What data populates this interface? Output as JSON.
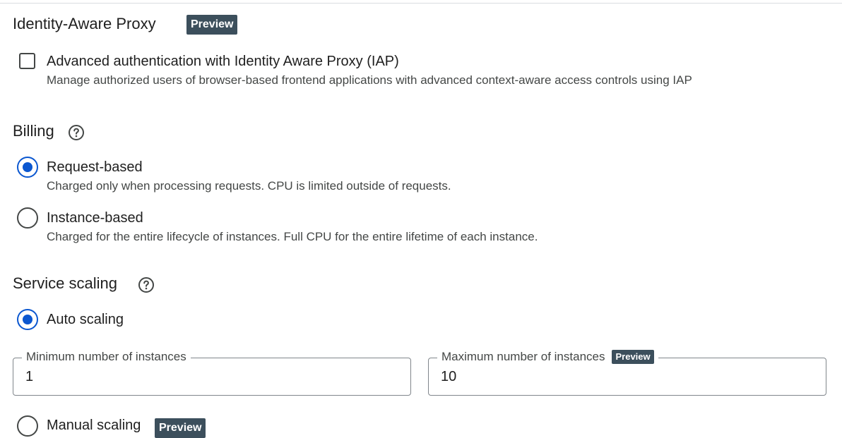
{
  "iap": {
    "title": "Identity-Aware Proxy",
    "badge": "Preview",
    "checkbox_label": "Advanced authentication with Identity Aware Proxy (IAP)",
    "checkbox_description": "Manage authorized users of browser-based frontend applications with advanced context-aware access controls using IAP",
    "checked": false
  },
  "billing": {
    "title": "Billing",
    "help_icon": "help-circle-icon",
    "options": [
      {
        "label": "Request-based",
        "description": "Charged only when processing requests. CPU is limited outside of requests.",
        "selected": true
      },
      {
        "label": "Instance-based",
        "description": "Charged for the entire lifecycle of instances. Full CPU for the entire lifetime of each instance.",
        "selected": false
      }
    ]
  },
  "scaling": {
    "title": "Service scaling",
    "help_icon": "help-circle-icon",
    "auto": {
      "label": "Auto scaling",
      "selected": true
    },
    "min_instances": {
      "label": "Minimum number of instances",
      "value": "1"
    },
    "max_instances": {
      "label": "Maximum number of instances",
      "badge": "Preview",
      "value": "10"
    },
    "manual": {
      "label": "Manual scaling",
      "badge": "Preview",
      "selected": false
    }
  },
  "colors": {
    "accent": "#0b57d0",
    "badge_bg": "#3c4f5c",
    "text_primary": "#1f1f1f",
    "text_secondary": "#444746"
  }
}
